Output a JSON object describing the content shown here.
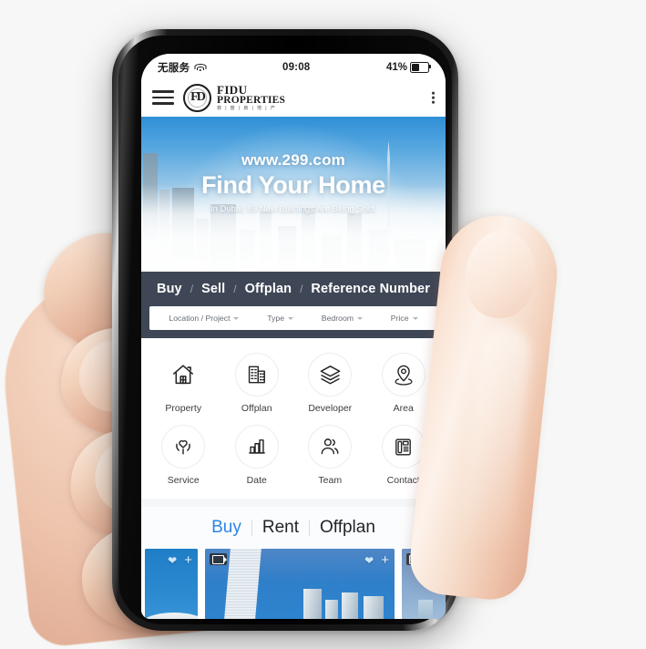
{
  "statusbar": {
    "carrier": "无服务",
    "wifi_icon": "wifi-icon",
    "time": "09:08",
    "battery_text": "41%",
    "battery_level": 41
  },
  "appbar": {
    "menu_icon": "hamburger-menu-icon",
    "logo_mark": "FD",
    "logo_line1": "FIDU",
    "logo_line2": "PROPERTIES",
    "logo_line3": "菲 | 度 | 房 | 地 | 产",
    "overflow_icon": "more-vertical-icon"
  },
  "hero": {
    "url": "www.299.com",
    "headline": "Find Your Home",
    "subline": "In Dubai, 86 New Buildings Are Being Sold."
  },
  "tabs": {
    "items": [
      "Buy",
      "Sell",
      "Offplan",
      "Reference Number"
    ],
    "separator": "/"
  },
  "filters": [
    {
      "label": "Location / Project",
      "icon": "chevron-down-icon"
    },
    {
      "label": "Type",
      "icon": "chevron-down-icon"
    },
    {
      "label": "Bedroom",
      "icon": "chevron-down-icon"
    },
    {
      "label": "Price",
      "icon": "chevron-down-icon"
    }
  ],
  "grid": {
    "row1": [
      {
        "label": "Property",
        "icon": "home-icon"
      },
      {
        "label": "Offplan",
        "icon": "buildings-icon"
      },
      {
        "label": "Developer",
        "icon": "layers-icon"
      },
      {
        "label": "Area",
        "icon": "map-pin-icon"
      }
    ],
    "row2": [
      {
        "label": "Service",
        "icon": "heart-in-hands-icon"
      },
      {
        "label": "Date",
        "icon": "bar-chart-icon"
      },
      {
        "label": "Team",
        "icon": "people-icon"
      },
      {
        "label": "Contact",
        "icon": "telephone-icon"
      }
    ]
  },
  "listing_tabs": {
    "items": [
      "Buy",
      "Rent",
      "Offplan"
    ],
    "active": "Buy",
    "active_color": "#2d84e8"
  },
  "cards": [
    {
      "favorite_icon": "heart-icon",
      "add_icon": "plus-icon"
    },
    {
      "video_icon": "video-camera-icon",
      "favorite_icon": "heart-icon",
      "add_icon": "plus-icon"
    },
    {
      "video_icon": "video-camera-icon"
    }
  ]
}
